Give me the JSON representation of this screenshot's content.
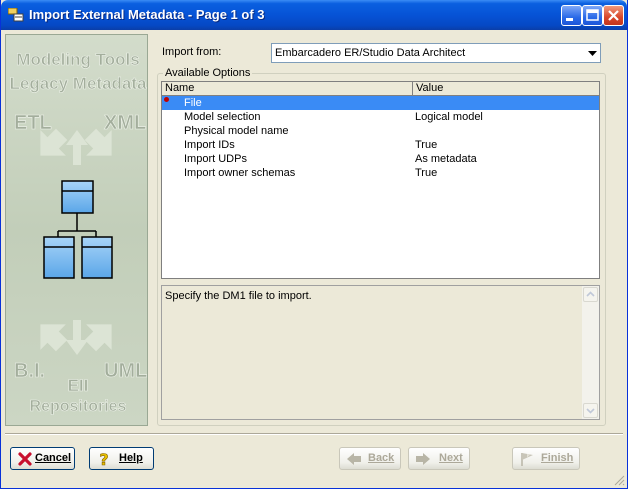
{
  "window": {
    "title": "Import External Metadata - Page 1 of 3",
    "icon": "import-metadata-app-icon"
  },
  "banner": {
    "lines": [
      "Modeling Tools",
      "Legacy Metadata",
      "ETL",
      "XML",
      "B.I.",
      "UML",
      "EII",
      "Repositories"
    ]
  },
  "import_from": {
    "label": "Import from:",
    "value": "Embarcadero ER/Studio Data Architect"
  },
  "options": {
    "group_label": "Available Options",
    "columns": [
      "Name",
      "Value"
    ],
    "rows": [
      {
        "name": "File",
        "value": "",
        "selected": true,
        "required": true
      },
      {
        "name": "Model selection",
        "value": "Logical model"
      },
      {
        "name": "Physical model name",
        "value": ""
      },
      {
        "name": "Import IDs",
        "value": "True"
      },
      {
        "name": "Import UDPs",
        "value": "As metadata"
      },
      {
        "name": "Import owner schemas",
        "value": "True"
      }
    ]
  },
  "description": "Specify the DM1 file to import.",
  "buttons": {
    "cancel": "Cancel",
    "help": "Help",
    "back": "Back",
    "next": "Next",
    "finish": "Finish"
  },
  "colors": {
    "selection": "#3a8bf5",
    "title_bar": "#0653d6",
    "dialog_bg": "#ece9d8",
    "banner_bg": "#c9d4c2"
  }
}
